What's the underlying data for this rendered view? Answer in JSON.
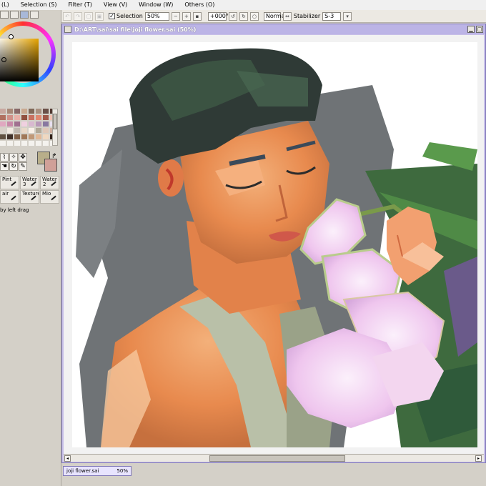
{
  "menubar": {
    "items": [
      "(L)",
      "Selection (S)",
      "Filter (T)",
      "View (V)",
      "Window (W)",
      "Others (O)"
    ]
  },
  "toolbar": {
    "selection_label": "Selection",
    "zoom_value": "50%",
    "rotation_value": "+000°",
    "blend_mode": "Normal",
    "stabilizer_label": "Stabilizer",
    "stabilizer_value": "S-3"
  },
  "left_panel": {
    "brushes": [
      {
        "label": "Pint",
        "size": ""
      },
      {
        "label": "Water",
        "size": "3"
      },
      {
        "label": "Water",
        "size": "2"
      },
      {
        "label": "air",
        "size": ""
      },
      {
        "label": "Texture",
        "size": ""
      },
      {
        "label": "Mio",
        "size": ""
      }
    ],
    "status_hint": "by left drag",
    "foreground_color": "#b8ae8a",
    "background_color": "#d0a098",
    "swatches": [
      "#c8a8a0",
      "#a88878",
      "#886868",
      "#c8a890",
      "#806858",
      "#a89080",
      "#6a5048",
      "#503830",
      "#b07060",
      "#d09088",
      "#e8b0a8",
      "#905040",
      "#c87060",
      "#e08870",
      "#a05848",
      "#f0c0b0",
      "#e0a8c0",
      "#c888a8",
      "#a07090",
      "#f0d0e0",
      "#d8b8d0",
      "#b898b8",
      "#8878a0",
      "#e8e0f0",
      "#d8d0c8",
      "#f0e8e0",
      "#c0b8b0",
      "#e8d8c8",
      "#f8f0e8",
      "#b0a898",
      "#e0c8b8",
      "#d0b0a0",
      "#605040",
      "#403028",
      "#806048",
      "#a07858",
      "#c09878",
      "#e0b898",
      "#f0d8c0",
      "#302018",
      "#f4f2ee",
      "#f4f2ee",
      "#f4f2ee",
      "#f4f2ee",
      "#f4f2ee",
      "#f4f2ee",
      "#f4f2ee",
      "#f4f2ee"
    ]
  },
  "document": {
    "title": "D:\\ART\\sai\\sai file\\joji flower.sai (50%)"
  },
  "file_tab": {
    "name": "joji flower.sai",
    "zoom": "50%"
  }
}
